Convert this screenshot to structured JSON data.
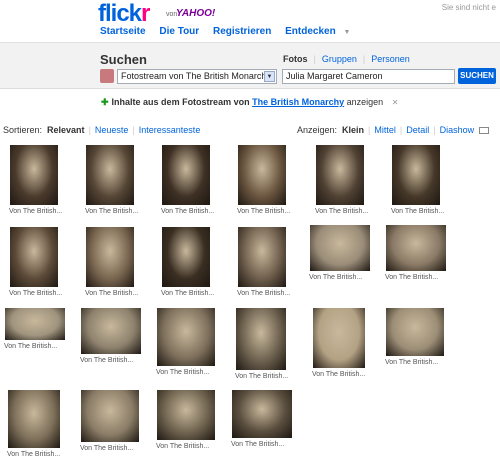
{
  "header": {
    "logo_main": "flick",
    "logo_accent": "r",
    "von": "von",
    "yahoo": "YAHOO!",
    "not_you": "Sie sind nicht e",
    "nav": [
      "Startseite",
      "Die Tour",
      "Registrieren",
      "Entdecken"
    ],
    "nav_more": "▼"
  },
  "search": {
    "title": "Suchen",
    "scopes": [
      "Fotos",
      "Gruppen",
      "Personen"
    ],
    "selected_scope": "Fotos",
    "source_value": "Fotostream von The British Monarchy",
    "query_value": "Julia Margaret Cameron",
    "button_label": "SUCHEN"
  },
  "scope_note": {
    "plus": "✚",
    "prefix": "Inhalte aus dem Fotostream von",
    "owner": "The British Monarchy",
    "suffix": "anzeigen",
    "close": "✕"
  },
  "sort": {
    "label": "Sortieren:",
    "options": [
      "Relevant",
      "Neueste",
      "Interessanteste"
    ],
    "selected": "Relevant"
  },
  "view": {
    "label": "Anzeigen:",
    "options": [
      "Klein",
      "Mittel",
      "Detail",
      "Diashow"
    ],
    "selected": "Klein"
  },
  "photos": [
    {
      "caption": "Von The British...",
      "tone": "#4a3a2c"
    },
    {
      "caption": "Von The British...",
      "tone": "#564636"
    },
    {
      "caption": "Von The British...",
      "tone": "#3e3024"
    },
    {
      "caption": "Von The British...",
      "tone": "#6a553f"
    },
    {
      "caption": "Von The British...",
      "tone": "#504133"
    },
    {
      "caption": "Von The British...",
      "tone": "#463829"
    },
    {
      "caption": "Von The British...",
      "tone": "#5c4a38"
    },
    {
      "caption": "Von The British...",
      "tone": "#7a6650"
    },
    {
      "caption": "Von The British...",
      "tone": "#3a2e22"
    },
    {
      "caption": "Von The British...",
      "tone": "#6e5e4c"
    },
    {
      "caption": "Von The British...",
      "tone": "#9a8c78"
    },
    {
      "caption": "Von The British...",
      "tone": "#8a7a66"
    },
    {
      "caption": "Von The British...",
      "tone": "#a0947e"
    },
    {
      "caption": "Von The British...",
      "tone": "#8e826e"
    },
    {
      "caption": "Von The British...",
      "tone": "#7e705c"
    },
    {
      "caption": "Von The British...",
      "tone": "#6c604e"
    },
    {
      "caption": "Von The British...",
      "tone": "#b4a284"
    },
    {
      "caption": "Von The British...",
      "tone": "#9c8e76"
    },
    {
      "caption": "Von The British...",
      "tone": "#7c6e58"
    },
    {
      "caption": "Von The British...",
      "tone": "#8a7c66"
    },
    {
      "caption": "Von The British...",
      "tone": "#6e624e"
    },
    {
      "caption": "Von The British...",
      "tone": "#5a4e3e"
    }
  ],
  "colors": {
    "brand_blue": "#0063dc",
    "brand_pink": "#ff0084"
  }
}
